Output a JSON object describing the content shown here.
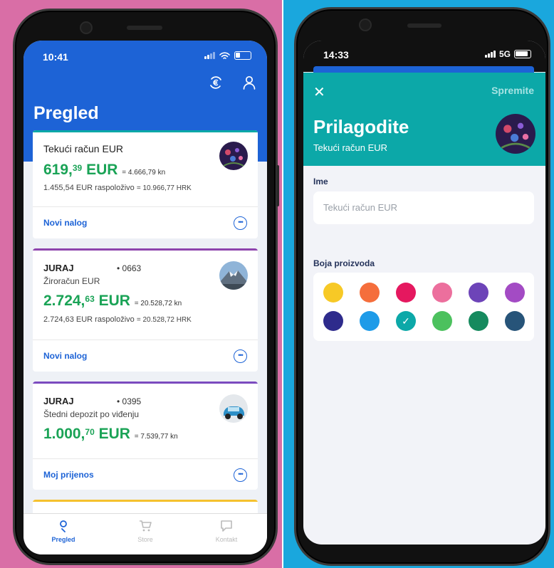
{
  "left_screen": {
    "status": {
      "time": "10:41"
    },
    "title": "Pregled",
    "accounts": [
      {
        "name": "Tekući račun EUR",
        "number": "",
        "subtitle": "",
        "amount_int": "619,",
        "amount_dec": "39",
        "currency": "EUR",
        "equiv": "= 4.666,79 kn",
        "available": "1.455,54 EUR raspoloživo",
        "available_equiv": "= 10.966,77 HRK",
        "action": "Novi nalog",
        "stripe_color": "#0ca8a8"
      },
      {
        "name": "JURAJ",
        "number": "• 0663",
        "subtitle": "Žiroračun EUR",
        "amount_int": "2.724,",
        "amount_dec": "63",
        "currency": "EUR",
        "equiv": "= 20.528,72 kn",
        "available": "2.724,63 EUR raspoloživo",
        "available_equiv": "= 20.528,72 HRK",
        "action": "Novi nalog",
        "stripe_color": "#8e44ad"
      },
      {
        "name": "JURAJ",
        "number": "• 0395",
        "subtitle": "Štedni depozit po viđenju",
        "amount_int": "1.000,",
        "amount_dec": "70",
        "currency": "EUR",
        "equiv": "= 7.539,77 kn",
        "action": "Moj prijenos",
        "stripe_color": "#7b4bbf"
      }
    ],
    "peek_stripe_color": "#f5c12e",
    "tabs": [
      {
        "label": "Pregled",
        "icon": "pin-icon",
        "active": true
      },
      {
        "label": "Store",
        "icon": "cart-icon",
        "active": false
      },
      {
        "label": "Kontakt",
        "icon": "chat-icon",
        "active": false
      }
    ]
  },
  "right_screen": {
    "status": {
      "time": "14:33",
      "network": "5G"
    },
    "save_label": "Spremite",
    "title": "Prilagodite",
    "subtitle": "Tekući račun EUR",
    "name_label": "Ime",
    "name_placeholder": "Tekući račun EUR",
    "color_label": "Boja proizvoda",
    "colors": [
      "#f7c926",
      "#f56e3c",
      "#e5185f",
      "#ec6f9d",
      "#6d44b8",
      "#a34bc4",
      "#2e2b8c",
      "#1e9be8",
      "#0ca8a8",
      "#4cc15e",
      "#168a5e",
      "#275479"
    ],
    "selected_color_index": 8
  },
  "colors": {
    "brand_blue": "#1d63d6",
    "teal": "#0ca8a8",
    "amount_green": "#1aa356"
  }
}
